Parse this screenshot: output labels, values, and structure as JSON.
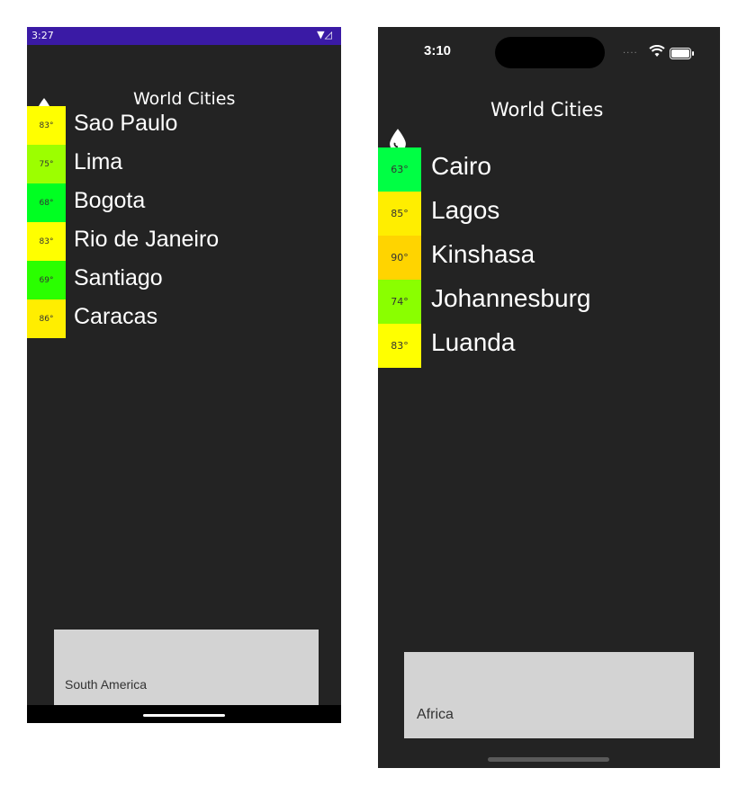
{
  "android": {
    "status_time": "3:27",
    "status_icons": "▼◿",
    "title": "World Cities",
    "accent": "#3a1aa5",
    "cities": [
      {
        "temp": "83°",
        "name": "Sao Paulo",
        "color": "#ffff00"
      },
      {
        "temp": "75°",
        "name": "Lima",
        "color": "#9cff00"
      },
      {
        "temp": "68°",
        "name": "Bogota",
        "color": "#00ff22"
      },
      {
        "temp": "83°",
        "name": "Rio de Janeiro",
        "color": "#ffff00"
      },
      {
        "temp": "69°",
        "name": "Santiago",
        "color": "#2aff00"
      },
      {
        "temp": "86°",
        "name": "Caracas",
        "color": "#ffee00"
      }
    ],
    "footer_label": "South America"
  },
  "ios": {
    "status_time": "3:10",
    "status_dots": "....",
    "title": "World Cities",
    "cities": [
      {
        "temp": "63°",
        "name": "Cairo",
        "color": "#00ff44"
      },
      {
        "temp": "85°",
        "name": "Lagos",
        "color": "#ffee00"
      },
      {
        "temp": "90°",
        "name": "Kinshasa",
        "color": "#ffd400"
      },
      {
        "temp": "74°",
        "name": "Johannesburg",
        "color": "#8aff00"
      },
      {
        "temp": "83°",
        "name": "Luanda",
        "color": "#ffff00"
      }
    ],
    "footer_label": "Africa"
  },
  "icons": {
    "app_icon": "water-drop-icon",
    "wifi": "wifi-icon",
    "battery": "battery-icon"
  }
}
